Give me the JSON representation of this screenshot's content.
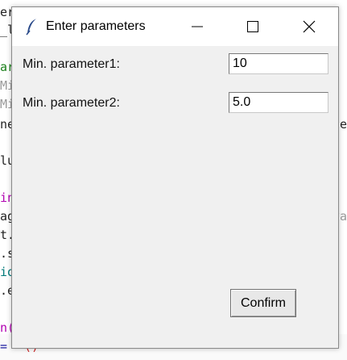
{
  "window": {
    "title": "Enter parameters",
    "minimize_label": "—",
    "maximize_label": "☐",
    "close_label": "✕"
  },
  "form": {
    "param1_label": "Min. parameter1:",
    "param1_value": "10",
    "param2_label": "Min. parameter2:",
    "param2_value": "5.0",
    "confirm_label": "Confirm"
  },
  "background_code": {
    "lines": [
      "er",
      "_l",
      "",
      "ar",
      "Mi",
      "Mi",
      "ne",
      "",
      "lu",
      "",
      "in",
      "ag",
      "t.",
      ".s",
      "io",
      ".e",
      "",
      "n(",
      "="
    ],
    "right_fragments": [
      "e",
      "va"
    ],
    "bottom_fragment": "()"
  },
  "colors": {
    "dialog_bg": "#f0f0f0",
    "titlebar_bg": "#ffffff",
    "accent_purple": "#b000b0",
    "accent_green": "#1a7f1a",
    "accent_teal": "#007a7a"
  },
  "icons": {
    "app": "feather-icon",
    "minimize": "minimize-icon",
    "maximize": "maximize-icon",
    "close": "close-icon"
  }
}
